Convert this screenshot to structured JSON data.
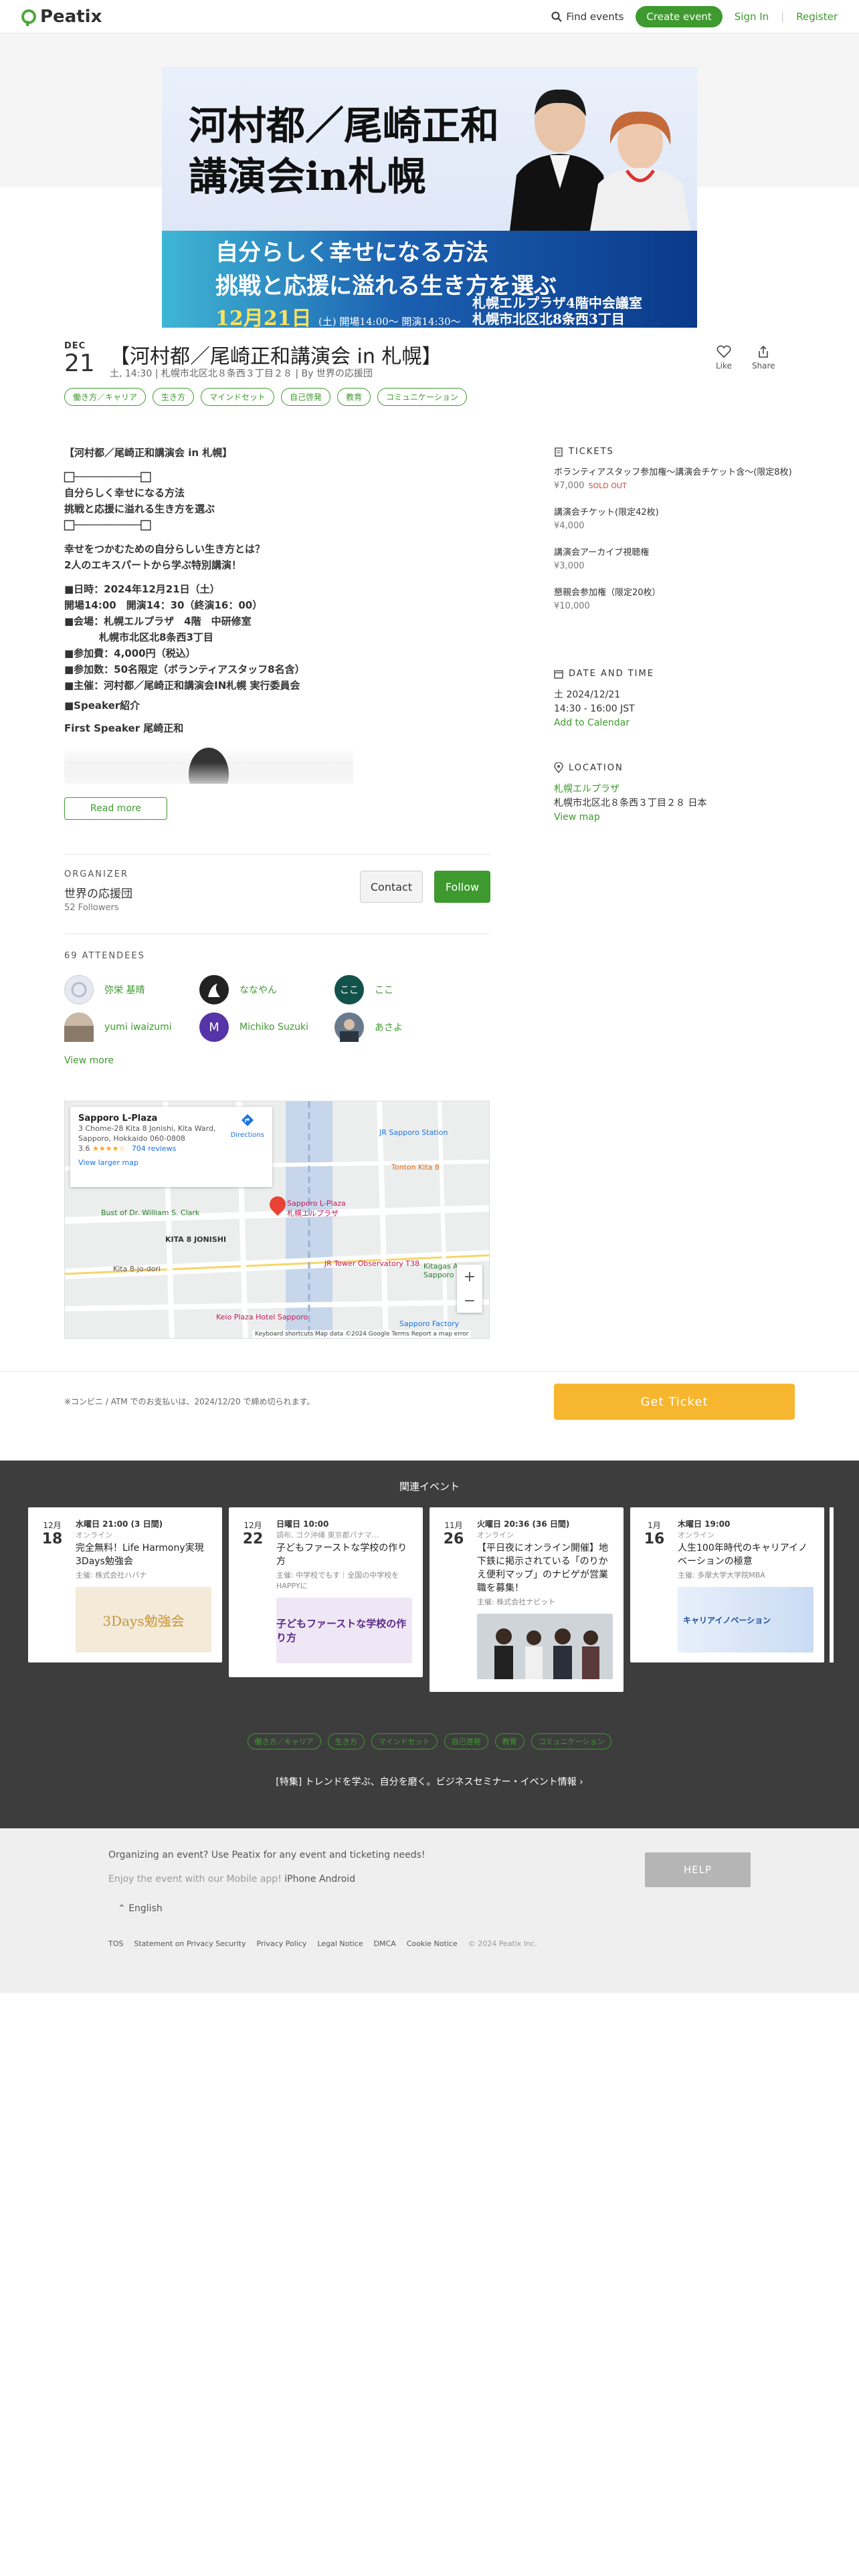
{
  "header": {
    "logo": "Peatix",
    "find_events": "Find events",
    "create_event": "Create event",
    "sign_in": "Sign In",
    "register": "Register",
    "separator": "|"
  },
  "hero": {
    "title_line1": "河村都／尾崎正和",
    "title_line2": "講演会in札幌",
    "subtitle_line1": "自分らしく幸せになる方法",
    "subtitle_line2": "挑戦と応援に溢れる生き方を選ぶ",
    "date_main": "12月21日",
    "date_small": "(土) 開場14:00〜 開演14:30〜",
    "venue_line1": "札幌エルプラザ4階中会議室",
    "venue_line2": "札幌市北区北8条西3丁目"
  },
  "event": {
    "month": "DEC",
    "day": "21",
    "title": "【河村都／尾崎正和講演会 in 札幌】",
    "meta": "土, 14:30 | 札幌市北区北８条西３丁目２８ | By 世界の応援団",
    "like": "Like",
    "share": "Share",
    "tags": [
      "働き方／キャリア",
      "生き方",
      "マインドセット",
      "自己啓発",
      "教育",
      "コミュニケーション"
    ]
  },
  "description": {
    "lines": [
      "【河村都／尾崎正和講演会 in 札幌】",
      "",
      "⬜︎───────────⬜︎",
      "自分らしく幸せになる方法",
      "挑戦と応援に溢れる生き方を選ぶ",
      "⬜︎───────────⬜︎",
      "",
      "幸せをつかむための自分らしい生き方とは？",
      "2人のエキスパートから学ぶ特別講演！",
      "",
      "■日時：2024年12月21日（土）",
      "開場14:00　開演14：30（終演16：00）",
      "■会場：札幌エルプラザ　4階　中研修室",
      "札幌市北区北8条西3丁目",
      "■参加費：4,000円（税込）",
      "■参加数：50名限定（ボランティアスタッフ8名含）",
      "■主催：河村都／尾崎正和講演会IN札幌 実行委員会",
      "",
      "■Speaker紹介"
    ],
    "speaker": "First Speaker 尾崎正和",
    "read_more": "Read more"
  },
  "tickets": {
    "heading": "TICKETS",
    "items": [
      {
        "name": "ボランティアスタッフ参加権〜講演会チケット含〜(限定8枚)",
        "price": "¥7,000",
        "status": "SOLD OUT"
      },
      {
        "name": "講演会チケット(限定42枚)",
        "price": "¥4,000",
        "status": ""
      },
      {
        "name": "講演会アーカイブ視聴権",
        "price": "¥3,000",
        "status": ""
      },
      {
        "name": "懇親会参加権（限定20枚）",
        "price": "¥10,000",
        "status": ""
      }
    ]
  },
  "datetime": {
    "heading": "DATE AND TIME",
    "date": "土 2024/12/21",
    "time": "14:30 - 16:00 JST",
    "add_calendar": "Add to Calendar"
  },
  "location": {
    "heading": "LOCATION",
    "venue": "札幌エルプラザ",
    "address": "札幌市北区北８条西３丁目２８ 日本",
    "view_map": "View map"
  },
  "organizer": {
    "label": "ORGANIZER",
    "name": "世界の応援団",
    "followers": "52 Followers",
    "contact": "Contact",
    "follow": "Follow"
  },
  "attendees": {
    "heading": "69 ATTENDEES",
    "people": [
      {
        "name": "弥栄 基晴",
        "initial": "",
        "color": "#e7e9f0"
      },
      {
        "name": "ななやん",
        "initial": "",
        "color": "#222222"
      },
      {
        "name": "ここ",
        "initial": "ここ",
        "color": "#12524a"
      },
      {
        "name": "yumi iwaizumi",
        "initial": "",
        "color": "#c9b9a6"
      },
      {
        "name": "Michiko Suzuki",
        "initial": "M",
        "color": "#5535a8"
      },
      {
        "name": "あさよ",
        "initial": "",
        "color": "#6a7a8c"
      }
    ],
    "view_more": "View more"
  },
  "map": {
    "place": "Sapporo L-Plaza",
    "address_line1": "3 Chome-28 Kita 8 Jonishi, Kita Ward,",
    "address_line2": "Sapporo, Hokkaido 060-0808",
    "rating": "3.6",
    "stars": "★★★★☆",
    "reviews": "704 reviews",
    "view_larger": "View larger map",
    "directions": "Directions",
    "pin_label_1": "Sapporo L-Plaza",
    "pin_label_2": "札幌エルプラザ",
    "labels": [
      "JR Sapporo Station",
      "Tonton Kita 8",
      "Bust of Dr. William S. Clark",
      "KITA 8 JONISHI",
      "Kita 8-jo-dori",
      "Keio Plaza Hotel Sapporo",
      "Sapporo Factory",
      "JR Tower Observatory T38",
      "Kitagas Arena Sapporo"
    ],
    "zoom_in": "+",
    "zoom_out": "−",
    "footer": "Keyboard shortcuts   Map data ©2024 Google   Terms   Report a map error"
  },
  "purchase": {
    "note": "※コンビニ / ATM でのお支払いは、2024/12/20 で締め切られます。",
    "button": "Get Ticket"
  },
  "related": {
    "heading": "関連イベント",
    "cards": [
      {
        "month": "12月",
        "day": "18",
        "time": "水曜日 21:00 (3 日間)",
        "mode": "オンライン",
        "title": "完全無料！Life Harmony実現3Days勉強会",
        "org": "主催: 株式会社ハバナ",
        "img_text": "3Days勉強会"
      },
      {
        "month": "12月",
        "day": "22",
        "time": "日曜日 10:00",
        "mode": "調布, ゴク沖縄 東京都パナマ…",
        "title": "子どもファーストな学校の作り方",
        "org": "主催: 中学校でもす｜全国の中学校をHAPPYに",
        "img_text": "子どもファーストな学校の作り方"
      },
      {
        "month": "11月",
        "day": "26",
        "time": "火曜日 20:36 (36 日間)",
        "mode": "オンライン",
        "title": "【平日夜にオンライン開催】地下鉄に掲示されている「のりかえ便利マップ」のナビゲが営業職を募集！",
        "org": "主催: 株式会社ナビット",
        "img_text": ""
      },
      {
        "month": "1月",
        "day": "16",
        "time": "木曜日 19:00",
        "mode": "オンライン",
        "title": "人生100年時代のキャリアイノベーションの極意",
        "org": "主催: 多摩大学大学院MBA",
        "img_text": "キャリアイノベーション"
      }
    ],
    "tags": [
      "働き方／キャリア",
      "生き方",
      "マインドセット",
      "自己啓発",
      "教育",
      "コミュニケーション"
    ],
    "feature": "[特集] トレンドを学ぶ、自分を磨く。ビジネスセミナー・イベント情報 ›"
  },
  "footer": {
    "organizing": "Organizing an event? Use Peatix for any event and ticketing needs!",
    "mobile": "Enjoy the event with our Mobile app!",
    "mobile_links": "iPhone Android",
    "help": "HELP",
    "language": "English",
    "links": [
      "TOS",
      "Statement on Privacy Security",
      "Privacy Policy",
      "Legal Notice",
      "DMCA",
      "Cookie Notice"
    ],
    "copyright": "© 2024 Peatix Inc."
  },
  "colors": {
    "brand_green": "#3e9a2e",
    "ticket_yellow": "#f6b62f",
    "sold_out_red": "#d04545"
  }
}
